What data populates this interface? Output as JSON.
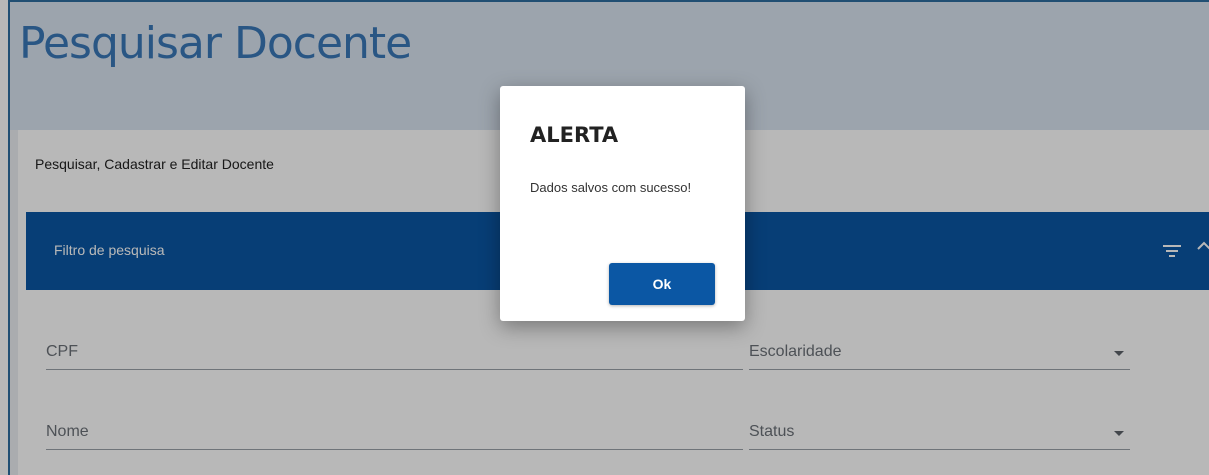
{
  "page": {
    "title": "Pesquisar Docente",
    "subtitle": "Pesquisar, Cadastrar e Editar Docente"
  },
  "filter": {
    "title": "Filtro de pesquisa",
    "icons": [
      "filter-icon",
      "chevron-up-icon"
    ],
    "bar_color": "#0b57a4"
  },
  "form": {
    "cpf_label": "CPF",
    "escolaridade_label": "Escolaridade",
    "nome_label": "Nome",
    "status_label": "Status"
  },
  "dialog": {
    "title": "ALERTA",
    "message": "Dados salvos com sucesso!",
    "ok_label": "Ok"
  },
  "colors": {
    "accent": "#0b57a4",
    "title": "#3a78b8"
  }
}
